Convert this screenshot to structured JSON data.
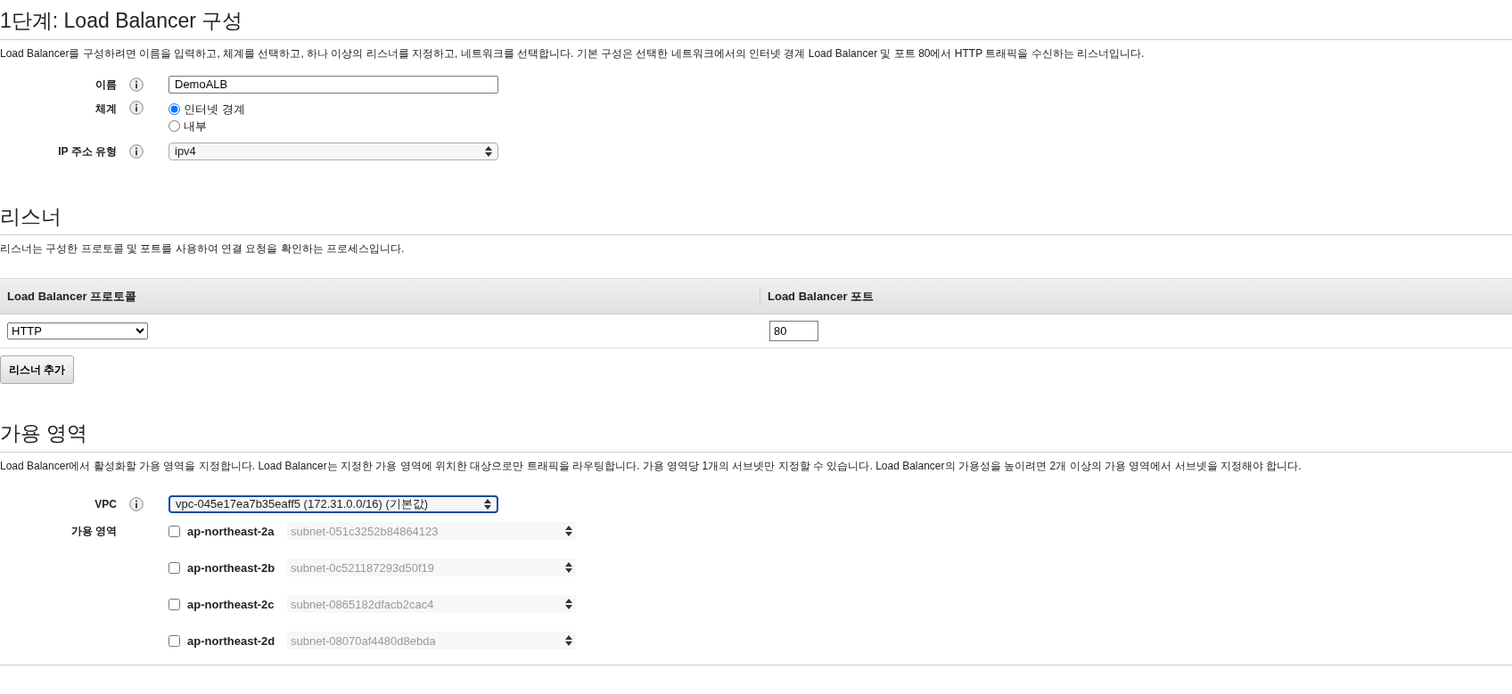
{
  "title": "1단계: Load Balancer 구성",
  "intro": "Load Balancer를 구성하려면 이름을 입력하고, 체계를 선택하고, 하나 이상의 리스너를 지정하고, 네트워크를 선택합니다. 기본 구성은 선택한 네트워크에서의 인터넷 경계 Load Balancer 및 포트 80에서 HTTP 트래픽을 수신하는 리스너입니다.",
  "name_field": {
    "label": "이름",
    "value": "DemoALB"
  },
  "scheme": {
    "label": "체계",
    "options": [
      {
        "label": "인터넷 경계",
        "selected": true
      },
      {
        "label": "내부",
        "selected": false
      }
    ]
  },
  "ip_type": {
    "label": "IP 주소 유형",
    "value": "ipv4"
  },
  "listeners": {
    "heading": "리스너",
    "description": "리스너는 구성한 프로토콜 및 포트를 사용하여 연결 요청을 확인하는 프로세스입니다.",
    "columns": [
      "Load Balancer 프로토콜",
      "Load Balancer 포트"
    ],
    "rows": [
      {
        "protocol": "HTTP",
        "port": "80"
      }
    ],
    "add_button": "리스너 추가"
  },
  "availability": {
    "heading": "가용 영역",
    "description": "Load Balancer에서 활성화할 가용 영역을 지정합니다. Load Balancer는 지정한 가용 영역에 위치한 대상으로만 트래픽을 라우팅합니다. 가용 영역당 1개의 서브넷만 지정할 수 있습니다. Load Balancer의 가용성을 높이려면 2개 이상의 가용 영역에서 서브넷을 지정해야 합니다.",
    "vpc_label": "VPC",
    "vpc_value": "vpc-045e17ea7b35eaff5 (172.31.0.0/16) (기본값)",
    "zones_label": "가용 영역",
    "zones": [
      {
        "name": "ap-northeast-2a",
        "subnet": "subnet-051c3252b84864123",
        "checked": false
      },
      {
        "name": "ap-northeast-2b",
        "subnet": "subnet-0c521187293d50f19",
        "checked": false
      },
      {
        "name": "ap-northeast-2c",
        "subnet": "subnet-0865182dfacb2cac4",
        "checked": false
      },
      {
        "name": "ap-northeast-2d",
        "subnet": "subnet-08070af4480d8ebda",
        "checked": false
      }
    ]
  }
}
